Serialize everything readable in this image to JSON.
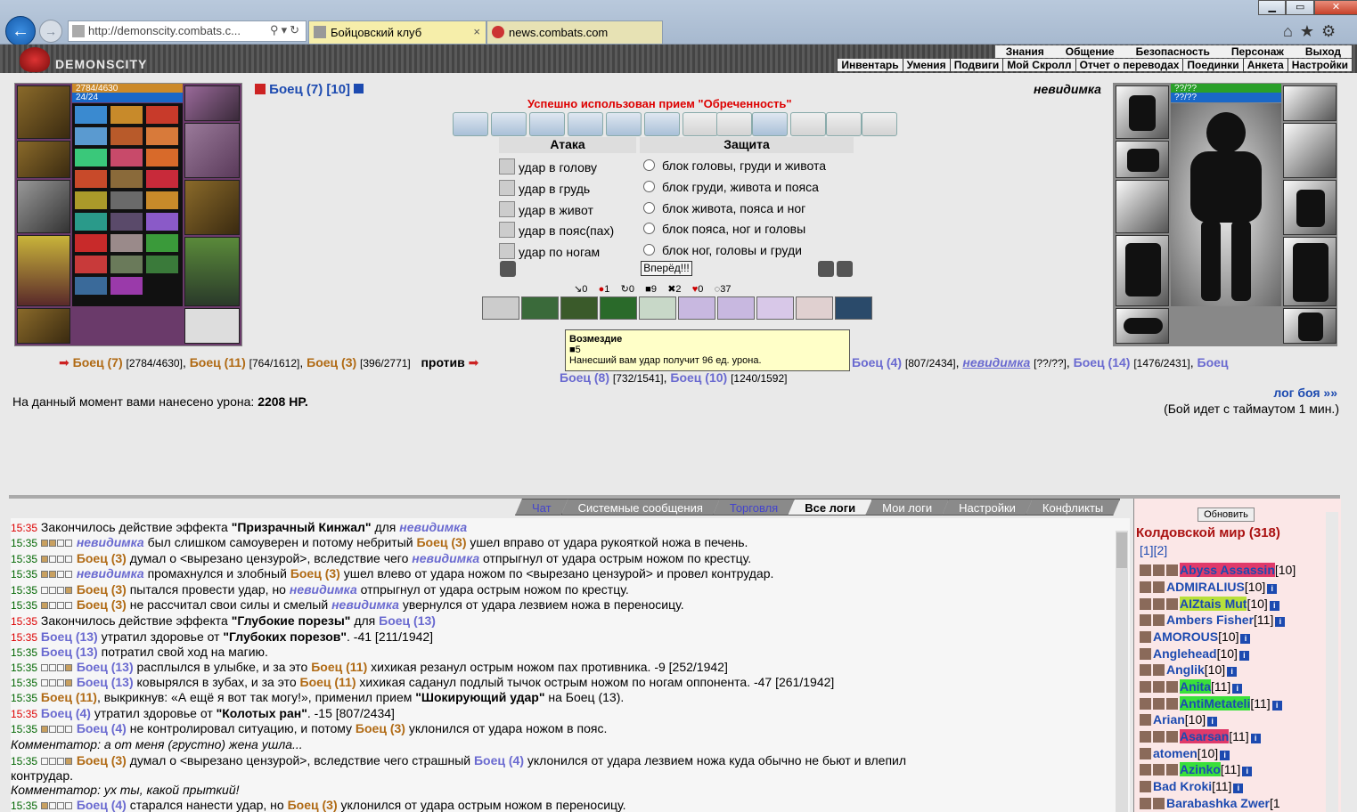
{
  "browser": {
    "url": "http://demonscity.combats.c...",
    "tabs": [
      {
        "label": "Бойцовский клуб"
      },
      {
        "label": "news.combats.com"
      }
    ]
  },
  "site": {
    "logo_text": "DEMONSCITY",
    "top_menu": [
      "Знания",
      "Общение",
      "Безопасность",
      "Персонаж",
      "Выход"
    ],
    "sub_menu": [
      "Инвентарь",
      "Умения",
      "Подвиги",
      "Мой Скролл",
      "Отчет о переводах",
      "Поединки",
      "Анкета",
      "Настройки"
    ]
  },
  "player": {
    "name": "Боец",
    "level": "(7)",
    "alt": "[10]",
    "hp": "2784/4630",
    "mana": "24/24",
    "hp_fraction": 0.6
  },
  "opponent": {
    "name": "невидимка",
    "hp": "??/??",
    "mana": "??/??"
  },
  "status_message": "Успешно использован прием \"Обреченность\"",
  "attack": {
    "title": "Атака",
    "options": [
      "удар в голову",
      "удар в грудь",
      "удар в живот",
      "удар в пояс(пах)",
      "удар по ногам"
    ]
  },
  "defense": {
    "title": "Защита",
    "options": [
      "блок головы, груди и живота",
      "блок груди, живота и пояса",
      "блок живота, пояса и ног",
      "блок пояса, ног и головы",
      "блок ног, головы и груди"
    ]
  },
  "go_button": "Вперёд!!!",
  "combat_stats": [
    "0",
    "1",
    "0",
    "9",
    "2",
    "0",
    "37"
  ],
  "tooltip": {
    "title": "Возмездие",
    "count": "5",
    "text": "Нанесший вам удар получит 96 ед. урона."
  },
  "teams": {
    "team1": [
      {
        "name": "Боец (7)",
        "hp": "[2784/4630]"
      },
      {
        "name": "Боец (11)",
        "hp": "[764/1612]"
      },
      {
        "name": "Боец (3)",
        "hp": "[396/2771]"
      }
    ],
    "vs": "против",
    "team2": [
      {
        "name": "Боец (4)",
        "hp": "[807/2434]"
      },
      {
        "name": "невидимка",
        "hp": "[??/??]"
      },
      {
        "name": "Боец (14)",
        "hp": "[1476/2431]"
      },
      {
        "name": "Боец (8)",
        "hp": "[732/1541]"
      },
      {
        "name": "Боец (10)",
        "hp": "[1240/1592]"
      }
    ]
  },
  "damage_text": "На данный момент вами нанесено урона:",
  "damage_value": "2208 HP.",
  "log_link": "лог боя »»",
  "timeout_text": "(Бой идет с таймаутом 1 мин.)",
  "bottom_tabs": [
    "Чат",
    "Системные сообщения",
    "Торговля",
    "Все логи",
    "Мои логи",
    "Настройки",
    "Конфликты"
  ],
  "refresh": "Обновить",
  "world": "Колдовской мир (318)",
  "pages": "[1][2]",
  "users": [
    {
      "name": "Abyss Assassin",
      "lv": "[10]"
    },
    {
      "name": "ADMIRALIUS",
      "lv": "[10]"
    },
    {
      "name": "AIZtais Mut",
      "lv": "[10]"
    },
    {
      "name": "Ambers Fisher",
      "lv": "[11]"
    },
    {
      "name": "AMOROUS",
      "lv": "[10]"
    },
    {
      "name": "Anglehead",
      "lv": "[10]"
    },
    {
      "name": "Anglik",
      "lv": "[10]"
    },
    {
      "name": "Anita",
      "lv": "[11]"
    },
    {
      "name": "AntiMetateli",
      "lv": "[11]"
    },
    {
      "name": "Arian",
      "lv": "[10]"
    },
    {
      "name": "Asarsan",
      "lv": "[11]"
    },
    {
      "name": "atomen",
      "lv": "[10]"
    },
    {
      "name": "Azinko",
      "lv": "[11]"
    },
    {
      "name": "Bad Kroki",
      "lv": "[11]"
    },
    {
      "name": "Barabashka Zwer",
      "lv": "[1"
    }
  ],
  "log": [
    {
      "time": "15:35",
      "a": "Закончилось действие эффекта ",
      "b": "\"Призрачный Кинжал\"",
      "c": " для ",
      "d": "невидимка"
    },
    {
      "time": "15:35",
      "a": "невидимка",
      "b": " был слишком самоуверен и потому небритый ",
      "c": "Боец (3)",
      "d": " ушел вправо от удара рукояткой ножа в печень."
    },
    {
      "time": "15:35",
      "a": "Боец (3)",
      "b": " думал о <вырезано цензурой>, вследствие чего ",
      "c": "невидимка",
      "d": " отпрыгнул от удара острым ножом по крестцу."
    },
    {
      "time": "15:35",
      "a": "невидимка",
      "b": " промахнулся и злобный ",
      "c": "Боец (3)",
      "d": " ушел влево от удара ножом по <вырезано цензурой> и провел контрудар."
    },
    {
      "time": "15:35",
      "a": "Боец (3)",
      "b": " пытался провести удар, но ",
      "c": "невидимка",
      "d": " отпрыгнул от удара острым ножом по крестцу."
    },
    {
      "time": "15:35",
      "a": "Боец (3)",
      "b": " не рассчитал свои силы и смелый ",
      "c": "невидимка",
      "d": " увернулся от удара лезвием ножа в переносицу."
    },
    {
      "time": "15:35",
      "a": "Закончилось действие эффекта ",
      "b": "\"Глубокие порезы\"",
      "c": " для ",
      "d": "Боец (13)"
    },
    {
      "time": "15:35",
      "a": "Боец (13)",
      "b": " утратил здоровье от ",
      "c": "\"Глубоких порезов\"",
      "d": ". -41 [211/1942]"
    },
    {
      "time": "15:35",
      "a": "Боец (13)",
      "b": " потратил свой ход на магию.",
      "c": "",
      "d": ""
    },
    {
      "time": "15:35",
      "a": "Боец (13)",
      "b": " расплылся в улыбке, и за это ",
      "c": "Боец (11)",
      "d": " хихикая резанул острым ножом пах противника. -9 [252/1942]"
    },
    {
      "time": "15:35",
      "a": "Боец (13)",
      "b": " ковырялся в зубах, и за это ",
      "c": "Боец (11)",
      "d": " хихикая саданул подлый тычок острым ножом по ногам оппонента. -47 [261/1942]"
    },
    {
      "time": "15:35",
      "a": "Боец (11)",
      "b": ", выкрикнув: «А ещё я вот так могу!», применил прием ",
      "c": "\"Шокирующий удар\"",
      "d": " на Боец (13)."
    },
    {
      "time": "15:35",
      "a": "Боец (4)",
      "b": " утратил здоровье от ",
      "c": "\"Колотых ран\"",
      "d": ". -15 [807/2434]"
    },
    {
      "time": "15:35",
      "a": "Боец (4)",
      "b": " не контролировал ситуацию, и потому ",
      "c": "Боец (3)",
      "d": " уклонился от удара ножом в пояс."
    },
    {
      "time": "",
      "a": "Комментатор: а от меня (грустно) жена ушла...",
      "b": "",
      "c": "",
      "d": ""
    },
    {
      "time": "15:35",
      "a": "Боец (3)",
      "b": " думал о <вырезано цензурой>, вследствие чего страшный ",
      "c": "Боец (4)",
      "d": " уклонился от удара лезвием ножа куда обычно не бьют и влепил"
    },
    {
      "time": "",
      "a": "контрудар.",
      "b": "",
      "c": "",
      "d": ""
    },
    {
      "time": "",
      "a": "Комментатор: ух ты, какой прыткий!",
      "b": "",
      "c": "",
      "d": ""
    },
    {
      "time": "15:35",
      "a": "Боец (4)",
      "b": " старался нанести удар, но ",
      "c": "Боец (3)",
      "d": " уклонился от удара острым ножом в переносицу."
    }
  ]
}
